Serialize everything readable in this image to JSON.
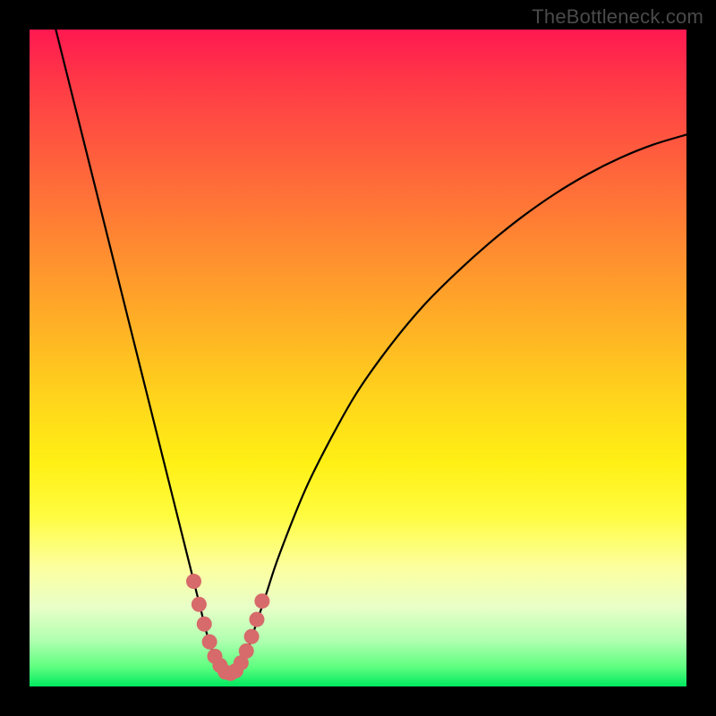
{
  "watermark": "TheBottleneck.com",
  "colors": {
    "page_bg": "#000000",
    "curve_stroke": "#000000",
    "marker_fill": "#d76a6a",
    "marker_stroke": "#d76a6a"
  },
  "chart_data": {
    "type": "line",
    "title": "",
    "xlabel": "",
    "ylabel": "",
    "xlim": [
      0,
      100
    ],
    "ylim": [
      0,
      100
    ],
    "grid": false,
    "legend": false,
    "series": [
      {
        "name": "bottleneck-curve",
        "x": [
          4,
          6,
          8,
          10,
          12,
          14,
          16,
          18,
          20,
          22,
          24,
          25,
          26,
          27,
          28,
          29,
          30,
          31,
          32,
          33,
          34,
          36,
          38,
          42,
          46,
          50,
          55,
          60,
          65,
          70,
          75,
          80,
          85,
          90,
          95,
          100
        ],
        "values": [
          100,
          92,
          84,
          76,
          68,
          60,
          52,
          44,
          36,
          28,
          20,
          16,
          12,
          8,
          5,
          3,
          2,
          2,
          3,
          5,
          8,
          14,
          20,
          30,
          38,
          45,
          52,
          58,
          63,
          67.5,
          71.5,
          75,
          78,
          80.5,
          82.5,
          84
        ]
      }
    ],
    "markers": {
      "name": "valley-markers",
      "x": [
        25.0,
        25.8,
        26.6,
        27.4,
        28.2,
        29.0,
        29.8,
        30.6,
        31.4,
        32.2,
        33.0,
        33.8,
        34.6,
        35.4
      ],
      "values": [
        16.0,
        12.5,
        9.5,
        6.8,
        4.6,
        3.2,
        2.2,
        2.0,
        2.4,
        3.6,
        5.4,
        7.6,
        10.2,
        13.0
      ]
    }
  }
}
